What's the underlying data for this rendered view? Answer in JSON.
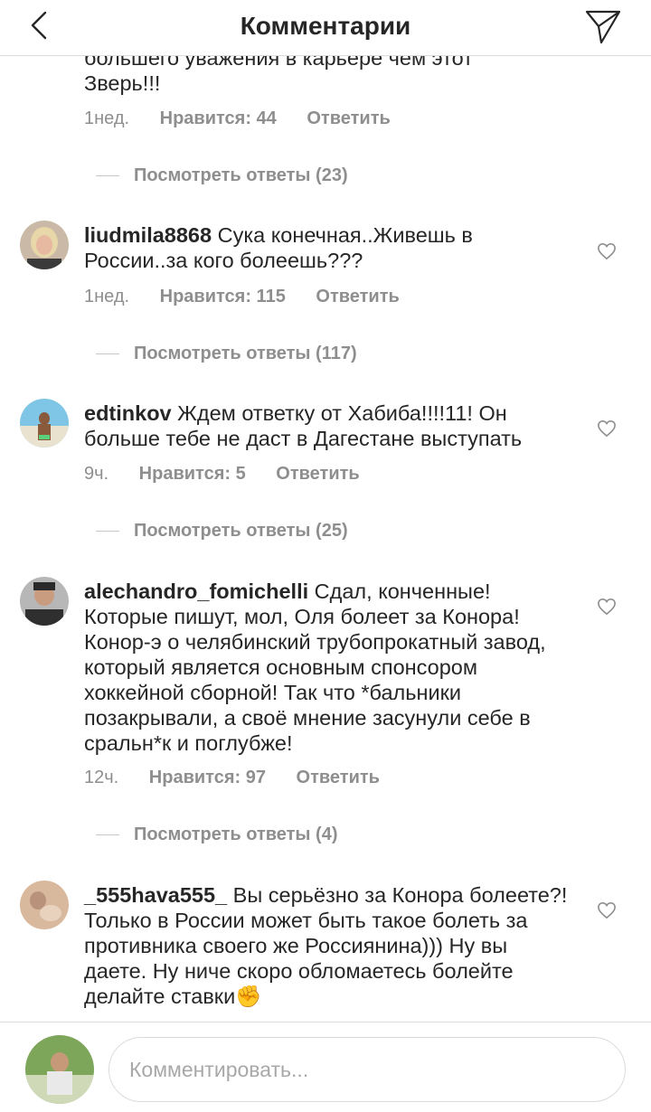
{
  "header": {
    "title": "Комментарии"
  },
  "top_comment": {
    "text_line1": "большего уважения в карьере чем этот",
    "text_line2": "Зверь!!!",
    "time": "1нед.",
    "likes": "Нравится: 44",
    "reply": "Ответить",
    "view_replies": "Посмотреть ответы (23)"
  },
  "comments": [
    {
      "user": "liudmila8868",
      "text": " Сука конечная..Живешь в России..за кого болеешь???",
      "time": "1нед.",
      "likes": "Нравится: 115",
      "reply": "Ответить",
      "view_replies": "Посмотреть ответы (117)"
    },
    {
      "user": "edtinkov",
      "text": " Ждем ответку от Хабиба!!!!11! Он больше тебе не даст в Дагестане выступать",
      "time": "9ч.",
      "likes": "Нравится: 5",
      "reply": "Ответить",
      "view_replies": "Посмотреть ответы (25)"
    },
    {
      "user": "alechandro_fomichelli",
      "text": " Сдал, конченные! Которые пишут, мол, Оля болеет за Конора! Конор-э о челябинский трубопрокатный завод, который является основным спонсором хоккейной сборной! Так что *бальники позакрывали, а своё мнение засунули себе в сральн*к и поглубже!",
      "time": "12ч.",
      "likes": "Нравится: 97",
      "reply": "Ответить",
      "view_replies": "Посмотреть ответы (4)"
    },
    {
      "user": "_555hava555_",
      "text": " Вы серьёзно за Конора болеете?! Только в России может быть такое болеть за противника своего же Россиянина))) Ну вы даете. Ну ниче скоро обломаетесь болейте делайте ставки",
      "emoji": "✊"
    }
  ],
  "footer": {
    "placeholder": "Комментировать..."
  },
  "icons": {
    "back": "chevron-left-icon",
    "send": "paper-plane-icon",
    "heart": "heart-outline-icon"
  }
}
